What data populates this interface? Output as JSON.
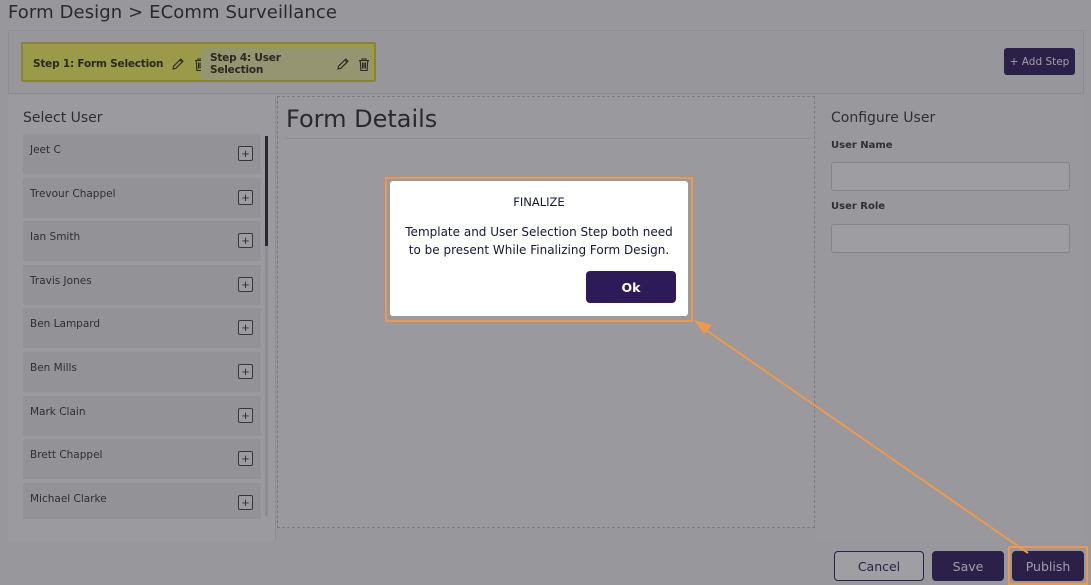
{
  "header": {
    "breadcrumb": "Form Design > EComm Surveillance"
  },
  "steps": [
    {
      "label": "Step 1: Form Selection",
      "edit_icon": "pencil-icon",
      "delete_icon": "trash-icon"
    },
    {
      "label": "Step 4: User Selection",
      "edit_icon": "pencil-icon",
      "delete_icon": "trash-icon"
    }
  ],
  "toolbar": {
    "add_step_label": "+ Add Step"
  },
  "select_user": {
    "title": "Select User",
    "add_icon": "plus-square-icon",
    "users": [
      "Jeet C",
      "Trevour Chappel",
      "Ian Smith",
      "Travis Jones",
      "Ben Lampard",
      "Ben Mills",
      "Mark Clain",
      "Brett Chappel",
      "Michael Clarke"
    ]
  },
  "form_details": {
    "title": "Form Details"
  },
  "configure_user": {
    "title": "Configure User",
    "user_name_label": "User Name",
    "user_name_value": "",
    "user_role_label": "User Role",
    "user_role_value": ""
  },
  "footer": {
    "cancel_label": "Cancel",
    "save_label": "Save",
    "publish_label": "Publish"
  },
  "modal": {
    "title": "FINALIZE",
    "message": "Template and User Selection Step both need to be present While Finalizing Form Design.",
    "ok_label": "Ok"
  },
  "colors": {
    "primary": "#2c1a59",
    "highlight_yellow": "#f7f75c",
    "annotation_orange": "#f0974a"
  }
}
